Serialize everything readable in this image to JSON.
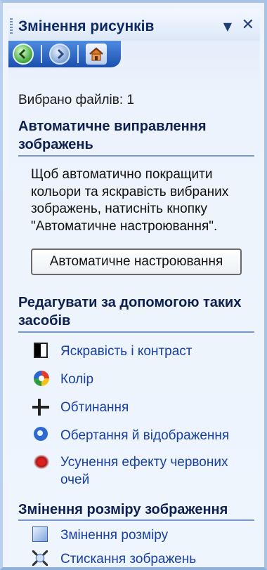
{
  "pane": {
    "title": "Змінення рисунків",
    "dropdown_glyph": "▼",
    "close_glyph": "✕"
  },
  "nav": {
    "icons": [
      "back-arrow-icon",
      "forward-arrow-icon",
      "home-icon"
    ]
  },
  "selection": {
    "files_label": "Вибрано файлів: 1"
  },
  "auto_correct": {
    "heading": "Автоматичне виправлення зображень",
    "description": "Щоб автоматично покращити кольори та яскравість вибраних зображень, натисніть кнопку \"Автоматичне настроювання\".",
    "button_label": "Автоматичне настроювання"
  },
  "edit_tools": {
    "heading": "Редагувати за допомогою таких засобів",
    "items": [
      {
        "label": "Яскравість і контраст",
        "icon": "brightness-contrast-icon"
      },
      {
        "label": "Колір",
        "icon": "color-wheel-icon"
      },
      {
        "label": "Обтинання",
        "icon": "crop-icon"
      },
      {
        "label": "Обертання й відображення",
        "icon": "rotate-flip-icon"
      },
      {
        "label": "Усунення ефекту червоних очей",
        "icon": "red-eye-icon"
      }
    ]
  },
  "resize_tools": {
    "heading": "Змінення розміру зображення",
    "items": [
      {
        "label": "Змінення розміру",
        "icon": "resize-icon"
      },
      {
        "label": "Стискання зображень",
        "icon": "compress-icon"
      }
    ]
  }
}
